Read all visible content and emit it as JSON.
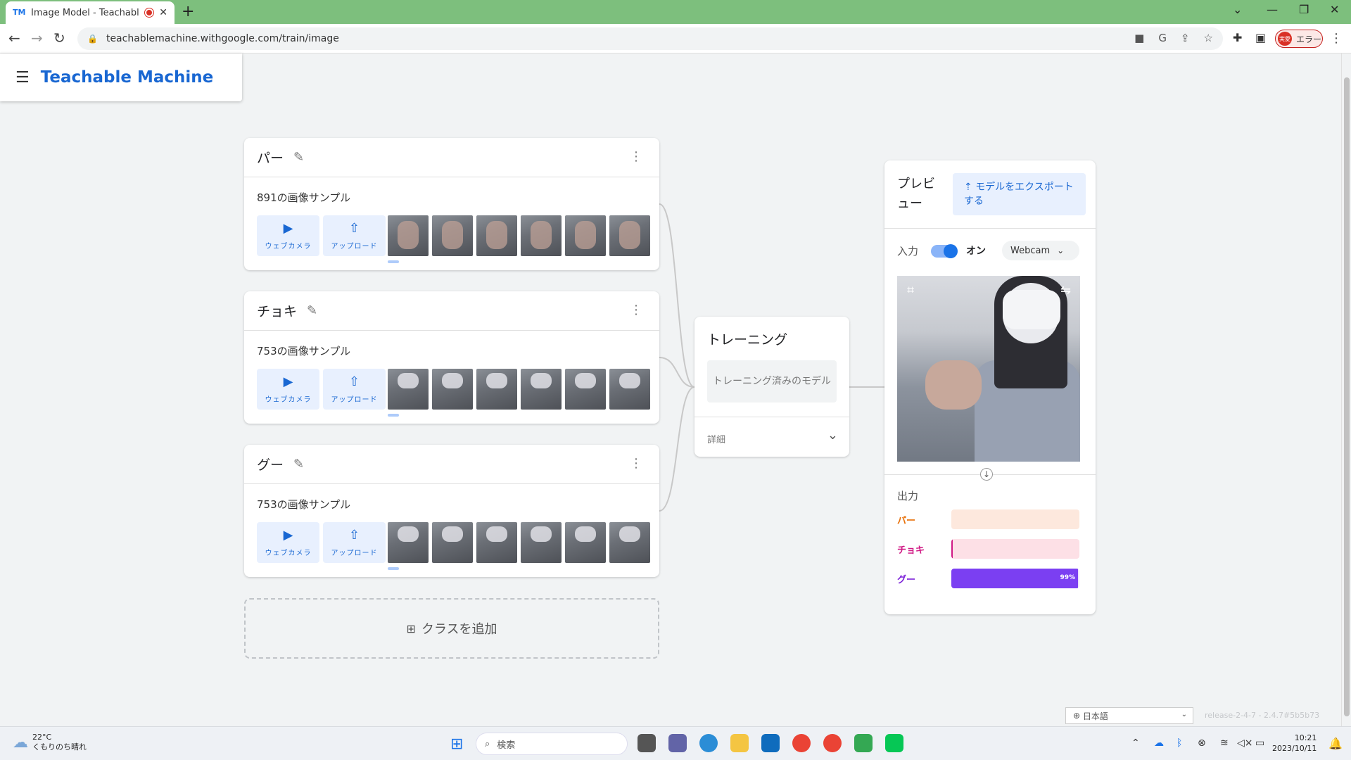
{
  "browser": {
    "tab_favicon": "TM",
    "tab_title": "Image Model - Teachable M",
    "new_tab": "+",
    "url": "teachablemachine.withgoogle.com/train/image",
    "profile_avatar": "実愛",
    "profile_label": "エラー"
  },
  "app": {
    "brand": "Teachable Machine"
  },
  "classes": [
    {
      "name": "パー",
      "samples": "891の画像サンプル",
      "webcam_label": "ウェブカメラ",
      "upload_label": "アップロード"
    },
    {
      "name": "チョキ",
      "samples": "753の画像サンプル",
      "webcam_label": "ウェブカメラ",
      "upload_label": "アップロード"
    },
    {
      "name": "グー",
      "samples": "753の画像サンプル",
      "webcam_label": "ウェブカメラ",
      "upload_label": "アップロード"
    }
  ],
  "add_class": "クラスを追加",
  "training": {
    "title": "トレーニング",
    "button": "トレーニング済みのモデル",
    "details": "詳細"
  },
  "preview": {
    "title": "プレビュー",
    "export": "モデルをエクスポートする",
    "input_label": "入力",
    "input_state": "オン",
    "source": "Webcam",
    "output_label": "出力",
    "outputs": [
      {
        "name": "パー",
        "color": "#e8710a",
        "bg": "#fde8dd",
        "fill": "#e8710a",
        "value": 0
      },
      {
        "name": "チョキ",
        "color": "#d01884",
        "bg": "#fde0e6",
        "fill": "#d01884",
        "value": 0.01
      },
      {
        "name": "グー",
        "color": "#7b1fd8",
        "bg": "#ece1fb",
        "fill": "#7b3ff2",
        "value": 0.99,
        "label": "99%"
      }
    ]
  },
  "footer": {
    "language": "日本語",
    "release": "release-2-4-7 - 2.4.7#5b5b73"
  },
  "taskbar": {
    "temp": "22°C",
    "weather": "くもりのち晴れ",
    "search": "検索",
    "time": "10:21",
    "date": "2023/10/11"
  }
}
